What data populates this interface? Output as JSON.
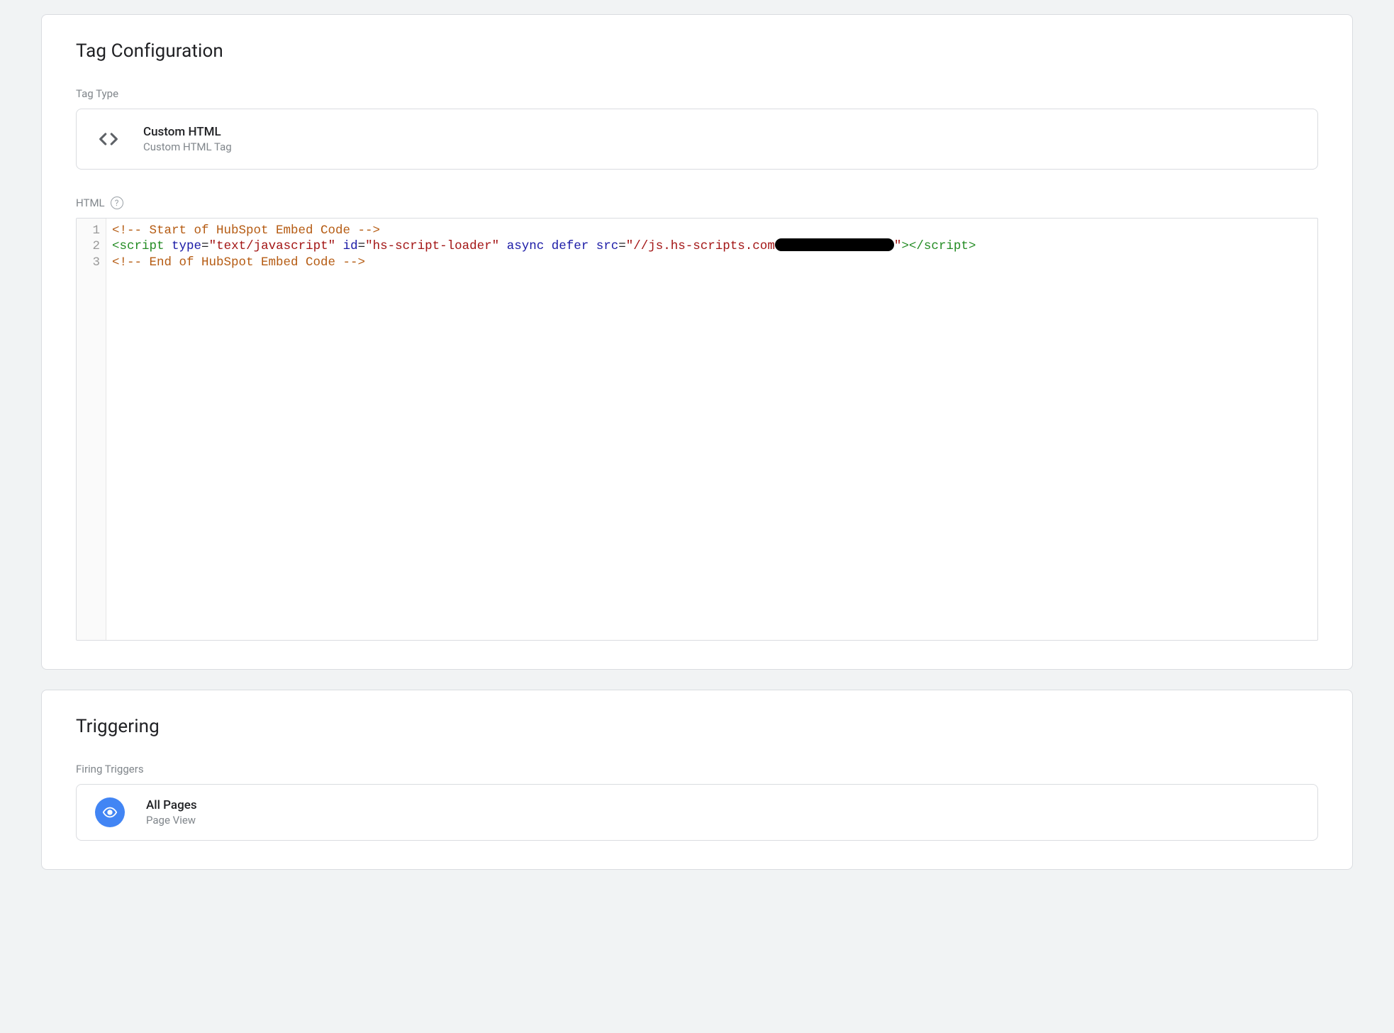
{
  "tagConfig": {
    "heading": "Tag Configuration",
    "tagTypeLabel": "Tag Type",
    "tagType": {
      "title": "Custom HTML",
      "subtitle": "Custom HTML Tag"
    },
    "htmlLabel": "HTML",
    "code": {
      "line1_comment": "<!-- Start of HubSpot Embed Code -->",
      "line2_tag_open": "<script",
      "line2_attr_type": "type",
      "line2_val_type": "\"text/javascript\"",
      "line2_attr_id": "id",
      "line2_val_id": "\"hs-script-loader\"",
      "line2_attr_async": "async",
      "line2_attr_defer": "defer",
      "line2_attr_src": "src",
      "line2_val_src_a": "\"//js.hs-scripts.com",
      "line2_val_src_b": "\"",
      "line2_tag_close": "></script>",
      "line3_comment": "<!-- End of HubSpot Embed Code -->",
      "gutter": [
        "1",
        "2",
        "3"
      ]
    }
  },
  "triggering": {
    "heading": "Triggering",
    "firingLabel": "Firing Triggers",
    "trigger": {
      "title": "All Pages",
      "subtitle": "Page View"
    }
  }
}
